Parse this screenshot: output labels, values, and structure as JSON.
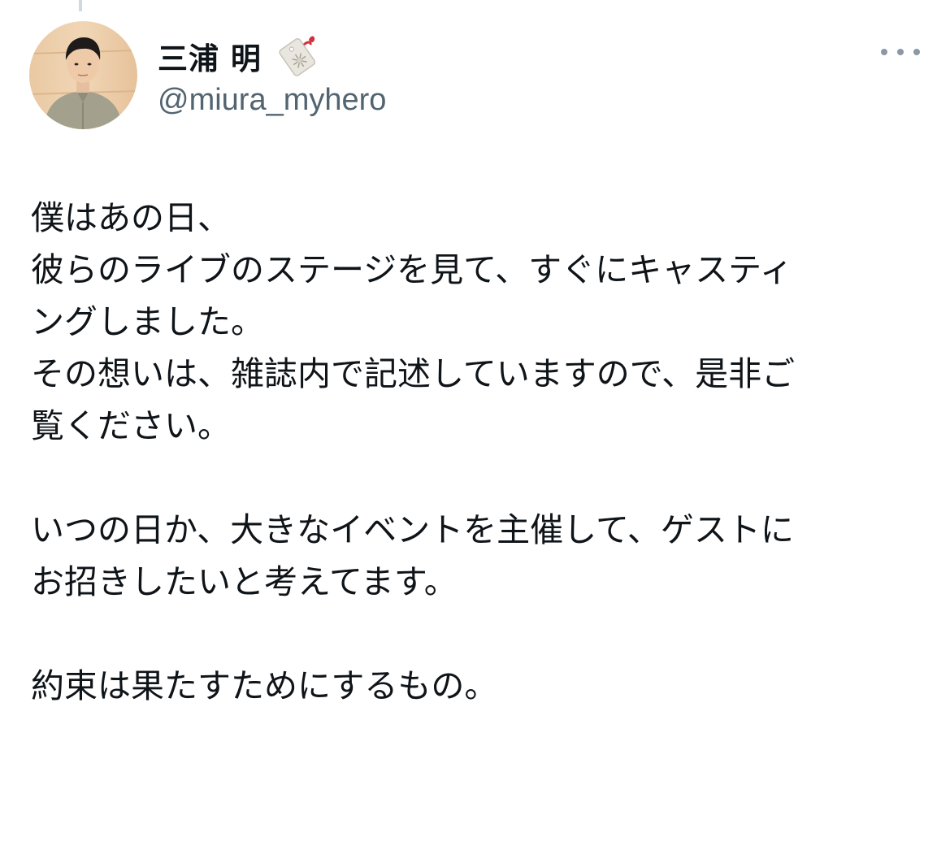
{
  "tweet": {
    "author": {
      "display_name": "三浦 明",
      "handle": "@miura_myhero",
      "badge_icon": "affiliate-tag-badge-icon"
    },
    "more_icon": "more-horizontal-icon",
    "body": {
      "paragraphs": [
        [
          "僕はあの日、",
          "彼らのライブのステージを見て、すぐにキャスティ",
          "ングしました。",
          "その想いは、雑誌内で記述していますので、是非ご",
          "覧ください。"
        ],
        [
          "いつの日か、大きなイベントを主催して、ゲストに",
          "お招きしたいと考えてます。"
        ],
        [
          "約束は果たすためにするもの。"
        ]
      ]
    }
  },
  "colors": {
    "text": "#0f1419",
    "secondary": "#536471",
    "thread_line": "#cfd9de"
  }
}
